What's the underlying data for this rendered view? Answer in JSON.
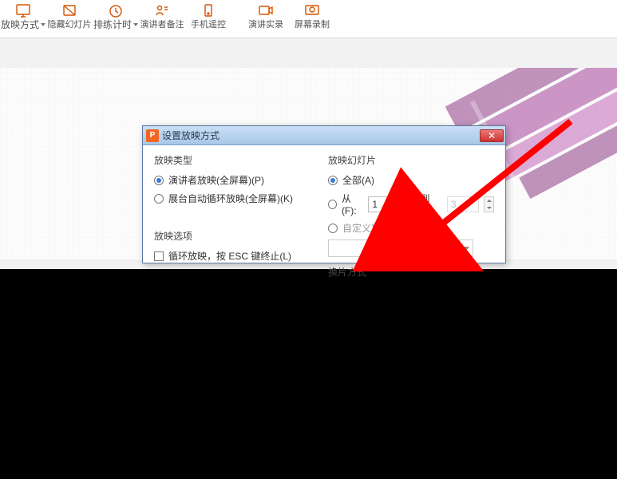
{
  "ribbon": {
    "playmode": "放映方式",
    "hide": "隐藏幻灯片",
    "rehearse": "排练计时",
    "notes": "演讲者备注",
    "remote": "手机遥控",
    "record_present": "演讲实录",
    "record_screen": "屏幕录制"
  },
  "dialog": {
    "title": "设置放映方式",
    "left_group": "放映类型",
    "type_presenter": "演讲者放映(全屏幕)(P)",
    "type_kiosk": "展台自动循环放映(全屏幕)(K)",
    "options_group": "放映选项",
    "loop": "循环放映，按 ESC 键终止(L)",
    "right_group": "放映幻灯片",
    "all": "全部(A)",
    "from_label": "从(F):",
    "from_value": "1",
    "to_label": "到(T):",
    "to_value": "3",
    "custom": "自定义放映(C):",
    "switch_group": "换片方式"
  }
}
